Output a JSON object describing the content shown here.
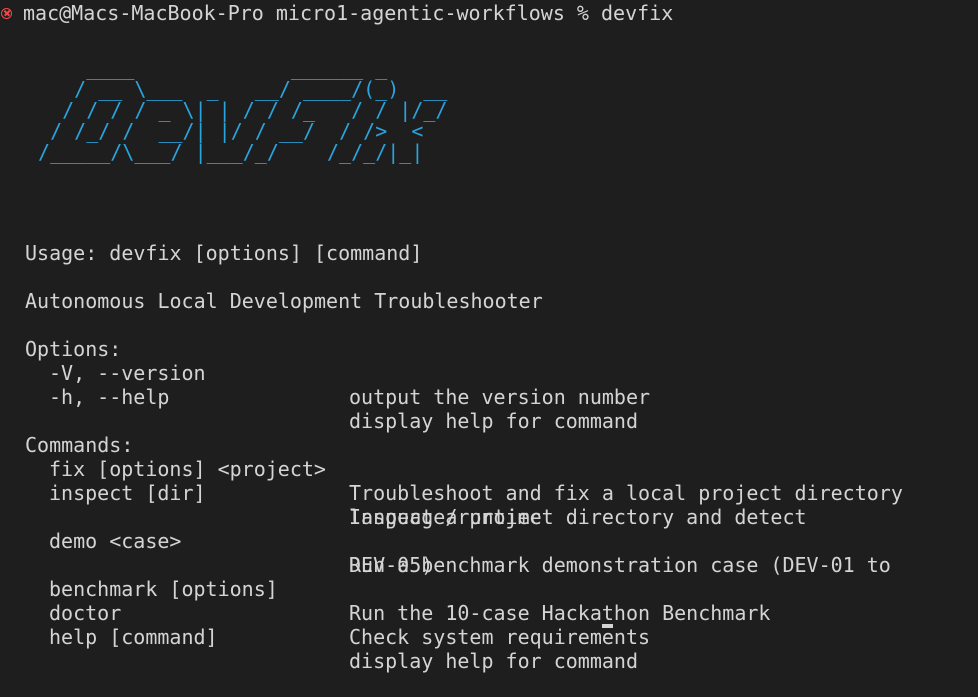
{
  "prompt": {
    "user_host": "mac@Macs-MacBook-Pro",
    "cwd": "micro1-agentic-workflows",
    "symbol": "%",
    "command": "devfix",
    "status_icon": "error-circle-icon",
    "status_color": "#f14c4c"
  },
  "banner": {
    "color": "#2aa4de",
    "art": "     ____             ______ _          \n    / __ \\___  _   __/ ____/(_)  __  \n   / / / / _ \\| | / / /_   / / |/_/  \n  / /_/ /  __/| |/ / __/  / />  <    \n /_____/\\___/ |___/_/    /_/_/|_|    "
  },
  "usage": "Usage: devfix [options] [command]",
  "description": "Autonomous Local Development Troubleshooter",
  "options": {
    "heading": "Options:",
    "items": [
      {
        "flag": "-V, --version",
        "desc": "output the version number"
      },
      {
        "flag": "-h, --help",
        "desc": "display help for command"
      }
    ]
  },
  "commands": {
    "heading": "Commands:",
    "items": [
      {
        "name": "fix [options] <project>",
        "desc": "Troubleshoot and fix a local project directory",
        "desc2": ""
      },
      {
        "name": "inspect [dir]",
        "desc": "Inspect a project directory and detect",
        "desc2": "language/runtime"
      },
      {
        "name": "demo <case>",
        "desc": "Run a benchmark demonstration case (DEV-01 to",
        "desc2": "DEV-05)"
      },
      {
        "name": "benchmark [options]",
        "desc": "Run the 10-case Hackathon Benchmark",
        "desc2": ""
      },
      {
        "name": "doctor",
        "desc": "Check system requirements",
        "desc2": ""
      },
      {
        "name": "help [command]",
        "desc": "display help for command",
        "desc2": ""
      }
    ]
  }
}
